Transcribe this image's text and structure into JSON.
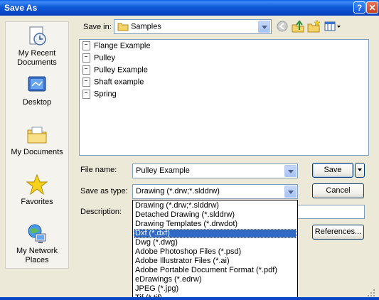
{
  "window": {
    "title": "Save As"
  },
  "places": [
    {
      "label": "My Recent Documents",
      "icon": "recent-documents-icon"
    },
    {
      "label": "Desktop",
      "icon": "desktop-icon"
    },
    {
      "label": "My Documents",
      "icon": "my-documents-icon"
    },
    {
      "label": "Favorites",
      "icon": "favorites-star-icon"
    },
    {
      "label": "My Network Places",
      "icon": "network-places-icon"
    }
  ],
  "save_in": {
    "label": "Save in:",
    "value": "Samples"
  },
  "files": [
    {
      "name": "Flange Example"
    },
    {
      "name": "Pulley"
    },
    {
      "name": "Pulley Example"
    },
    {
      "name": "Shaft example"
    },
    {
      "name": "Spring"
    }
  ],
  "file_name": {
    "label": "File name:",
    "value": "Pulley Example"
  },
  "save_as_type": {
    "label": "Save as type:",
    "value": "Drawing (*.drw;*.slddrw)",
    "options": [
      "Drawing (*.drw;*.slddrw)",
      "Detached Drawing (*.slddrw)",
      "Drawing Templates (*.drwdot)",
      "Dxf (*.dxf)",
      "Dwg (*.dwg)",
      "Adobe Photoshop Files (*.psd)",
      "Adobe Illustrator Files (*.ai)",
      "Adobe Portable Document Format (*.pdf)",
      "eDrawings (*.edrw)",
      "JPEG (*.jpg)",
      "Tif (*.tif)"
    ],
    "highlighted": "Dxf (*.dxf)"
  },
  "description": {
    "label": "Description:",
    "value": ""
  },
  "buttons": {
    "save": "Save",
    "cancel": "Cancel",
    "references": "References..."
  },
  "colors": {
    "titlebar": "#0848c8",
    "highlight": "#316ac5",
    "dialog_bg": "#ece9d8"
  }
}
